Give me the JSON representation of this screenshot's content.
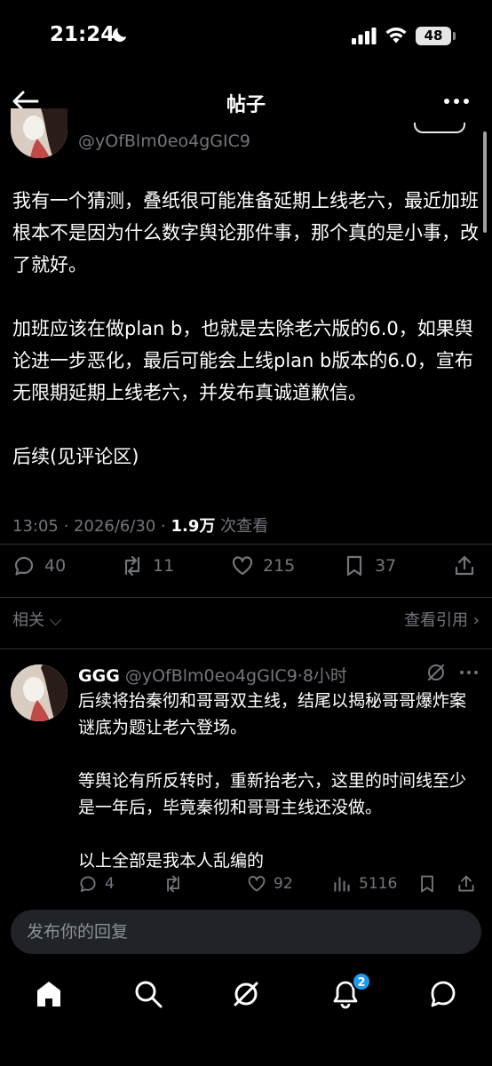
{
  "status_bar": {
    "time": "21:24",
    "battery": "48"
  },
  "header": {
    "title": "帖子"
  },
  "author": {
    "handle": "@yOfBlm0eo4gGIC9"
  },
  "post": {
    "paragraphs": [
      "我有一个猜测，叠纸很可能准备延期上线老六，最近加班根本不是因为什么数字舆论那件事，那个真的是小事，改了就好。",
      "加班应该在做plan b，也就是去除老六版的6.0，如果舆论进一步恶化，最后可能会上线plan b版本的6.0，宣布无限期延期上线老六，并发布真诚道歉信。",
      "后续(见评论区)"
    ],
    "timestamp": "13:05 · 2026/6/30 · ",
    "views": "1.9万",
    "views_label": " 次查看"
  },
  "actions": {
    "replies": "40",
    "reposts": "11",
    "likes": "215",
    "bookmarks": "37"
  },
  "related": {
    "label": "相关",
    "quotes_label": "查看引用"
  },
  "reply": {
    "name": "GGG",
    "handle": "@yOfBlm0eo4gGIC9",
    "time": "8小时",
    "paragraphs": [
      "后续将抬秦彻和哥哥双主线，结尾以揭秘哥哥爆炸案谜底为题让老六登场。",
      "等舆论有所反转时，重新抬老六，这里的时间线至少是一年后，毕竟秦彻和哥哥主线还没做。",
      "以上全部是我本人乱编的"
    ],
    "replies": "4",
    "likes": "92",
    "views": "5116"
  },
  "compose": {
    "placeholder": "发布你的回复"
  },
  "tabs": {
    "notifications_badge": "2"
  },
  "colors": {
    "background": "#000000",
    "text": "#e7e9ea",
    "muted": "#71767b",
    "accent": "#1d9bf0"
  },
  "icons": [
    "back-arrow-icon",
    "more-icon",
    "reply-icon",
    "repost-icon",
    "like-icon",
    "bookmark-icon",
    "share-icon",
    "views-icon",
    "grok-icon",
    "home-icon",
    "search-icon",
    "notifications-icon",
    "messages-icon"
  ]
}
